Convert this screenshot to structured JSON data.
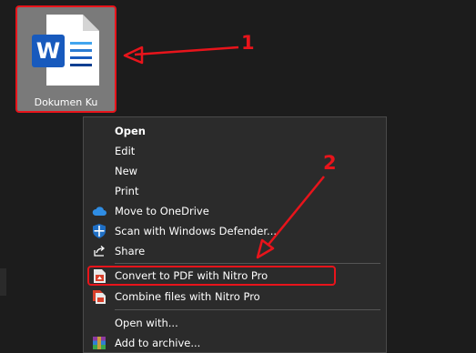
{
  "desktop": {
    "file_label": "Dokumen Ku",
    "file_icon": "word-document-icon"
  },
  "annotations": {
    "step1": "1",
    "step2": "2",
    "color": "#e8141b"
  },
  "context_menu": {
    "items": [
      {
        "label": "Open",
        "bold": true
      },
      {
        "label": "Edit"
      },
      {
        "label": "New"
      },
      {
        "label": "Print"
      },
      {
        "label": "Move to OneDrive",
        "icon": "onedrive-cloud-icon"
      },
      {
        "label": "Scan with Windows Defender...",
        "icon": "windows-defender-shield-icon"
      },
      {
        "label": "Share",
        "icon": "share-icon"
      },
      {
        "label": "Convert to PDF with Nitro Pro",
        "icon": "nitro-pdf-icon"
      },
      {
        "label": "Combine files with Nitro Pro",
        "icon": "nitro-combine-icon"
      },
      {
        "label": "Open with..."
      },
      {
        "label": "Add to archive...",
        "icon": "winrar-archive-icon"
      }
    ]
  },
  "colors": {
    "background": "#1c1c1c",
    "menu_background": "#2b2b2b",
    "icon_tile": "#7a7a7a",
    "word_blue": "#185abd"
  }
}
